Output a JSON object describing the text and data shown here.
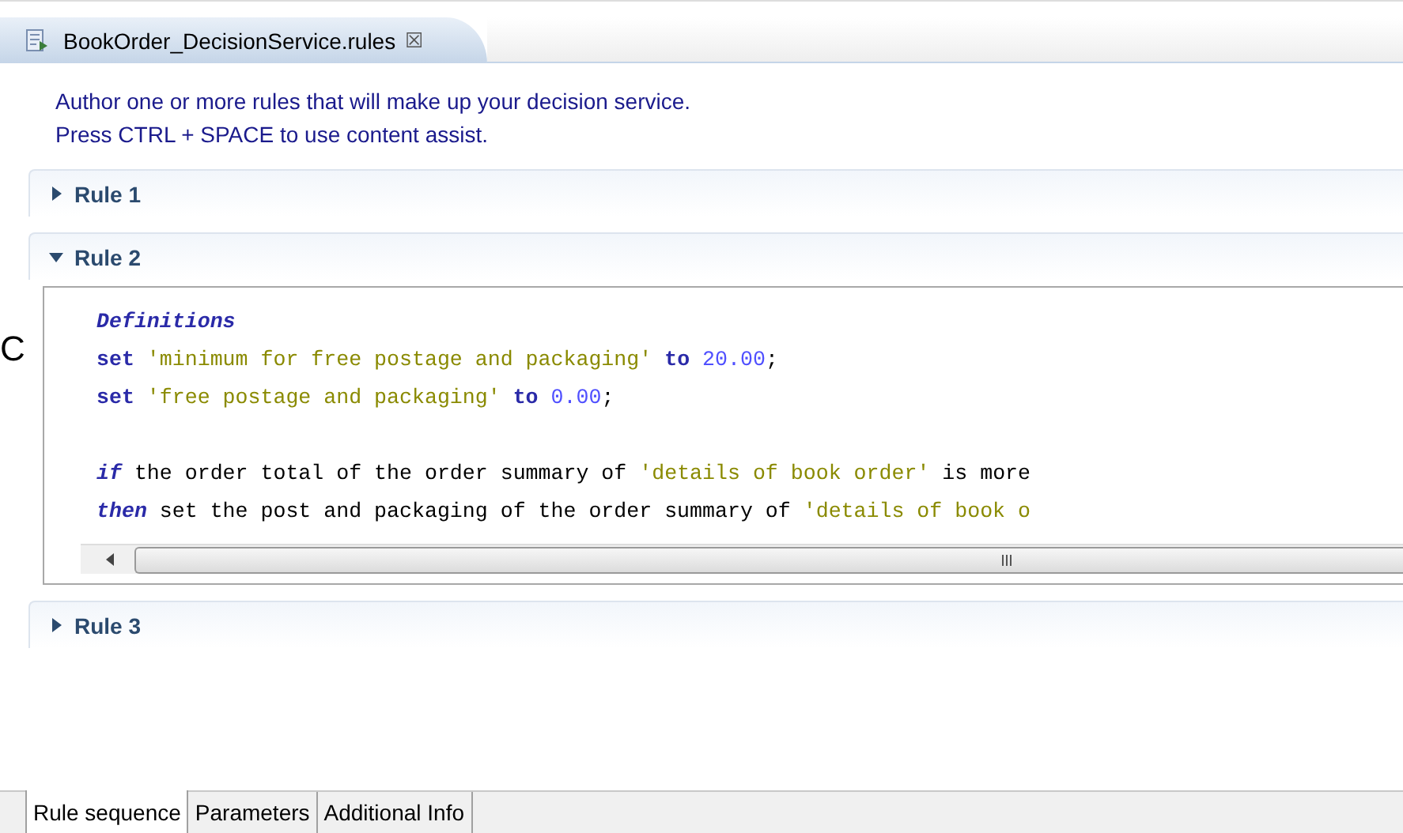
{
  "editor_tab": {
    "title": "BookOrder_DecisionService.rules",
    "close": "☒"
  },
  "edge_text": "C",
  "instructions": [
    "Author one or more rules that will make up your decision service.",
    "Press CTRL + SPACE to use content assist."
  ],
  "rules": [
    {
      "title": "Rule 1",
      "expanded": false
    },
    {
      "title": "Rule 2",
      "expanded": true,
      "code": [
        {
          "tokens": [
            {
              "kind": "keyword-italic",
              "text": "Definitions"
            }
          ]
        },
        {
          "tokens": [
            {
              "kind": "keyword",
              "text": "set "
            },
            {
              "kind": "string",
              "text": "'minimum for free postage and packaging' "
            },
            {
              "kind": "keyword",
              "text": "to "
            },
            {
              "kind": "number",
              "text": "20.00"
            },
            {
              "kind": "plain",
              "text": ";"
            }
          ]
        },
        {
          "tokens": [
            {
              "kind": "keyword",
              "text": "set "
            },
            {
              "kind": "string",
              "text": "'free postage and packaging' "
            },
            {
              "kind": "keyword",
              "text": "to "
            },
            {
              "kind": "number",
              "text": "0.00"
            },
            {
              "kind": "plain",
              "text": ";"
            }
          ]
        },
        {
          "gap_before": true,
          "tokens": [
            {
              "kind": "keyword-italic",
              "text": "if"
            },
            {
              "kind": "plain",
              "text": " the order total of the order summary of "
            },
            {
              "kind": "string",
              "text": "'details of book order'"
            },
            {
              "kind": "plain",
              "text": " is more"
            }
          ]
        },
        {
          "tokens": [
            {
              "kind": "keyword-italic",
              "text": "then"
            },
            {
              "kind": "plain",
              "text": " set the post and packaging of the order summary of "
            },
            {
              "kind": "string",
              "text": "'details of book o"
            }
          ]
        }
      ]
    },
    {
      "title": "Rule 3",
      "expanded": false
    }
  ],
  "bottom_tabs": [
    {
      "label": "Rule sequence",
      "selected": true
    },
    {
      "label": "Parameters",
      "selected": false
    },
    {
      "label": "Additional Info",
      "selected": false
    }
  ]
}
